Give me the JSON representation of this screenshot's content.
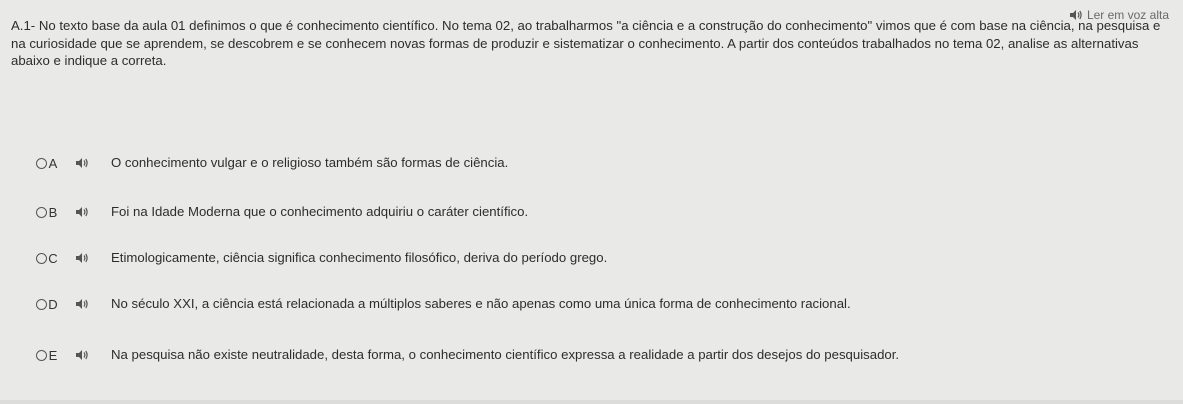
{
  "read_aloud": {
    "label": "Ler em voz alta",
    "icon": "speaker-icon"
  },
  "question": {
    "text": "A.1- No texto base da aula 01 definimos o que é conhecimento científico. No tema 02, ao trabalharmos \"a ciência e a construção do conhecimento\" vimos que é com base na ciência, na pesquisa e na curiosidade que se aprendem, se descobrem e se conhecem novas formas de produzir e sistematizar o conhecimento. A partir dos conteúdos trabalhados no tema 02, analise as alternativas abaixo e indique a correta."
  },
  "options": [
    {
      "letter": "A",
      "text": "O conhecimento vulgar e o religioso também são formas de ciência."
    },
    {
      "letter": "B",
      "text": "Foi na Idade Moderna que o conhecimento adquiriu o caráter científico."
    },
    {
      "letter": "C",
      "text": "Etimologicamente, ciência significa conhecimento filosófico, deriva do período grego."
    },
    {
      "letter": "D",
      "text": "No século XXI, a ciência está relacionada a múltiplos saberes e não apenas como uma única forma de conhecimento racional."
    },
    {
      "letter": "E",
      "text": "Na pesquisa não existe neutralidade, desta forma, o conhecimento científico expressa a realidade a partir dos desejos do pesquisador."
    }
  ],
  "colors": {
    "background": "#e9e9e7",
    "text": "#2d2d2d",
    "muted": "#6a6a6a"
  }
}
